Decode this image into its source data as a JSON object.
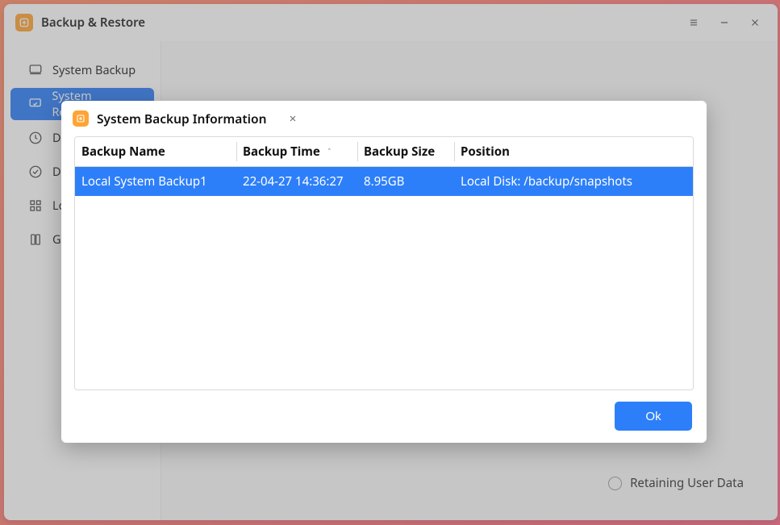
{
  "window": {
    "title": "Backup & Restore"
  },
  "sidebar": {
    "items": [
      {
        "label": "System Backup"
      },
      {
        "label": "System Recovery"
      },
      {
        "label": "Data Backup"
      },
      {
        "label": "Data Recovery"
      },
      {
        "label": "Log Query"
      },
      {
        "label": "Ghost"
      }
    ],
    "active_index": 1
  },
  "content": {
    "retain_label": "Retaining User Data",
    "retain_checked": false
  },
  "dialog": {
    "title": "System Backup Information",
    "columns": {
      "name": "Backup Name",
      "time": "Backup Time",
      "size": "Backup Size",
      "pos": "Position"
    },
    "sort_column": "time",
    "sort_dir": "asc",
    "rows": [
      {
        "name": "Local System Backup1",
        "time": "22-04-27 14:36:27",
        "size": "8.95GB",
        "pos": "Local Disk: /backup/snapshots",
        "selected": true
      }
    ],
    "ok_label": "Ok"
  }
}
